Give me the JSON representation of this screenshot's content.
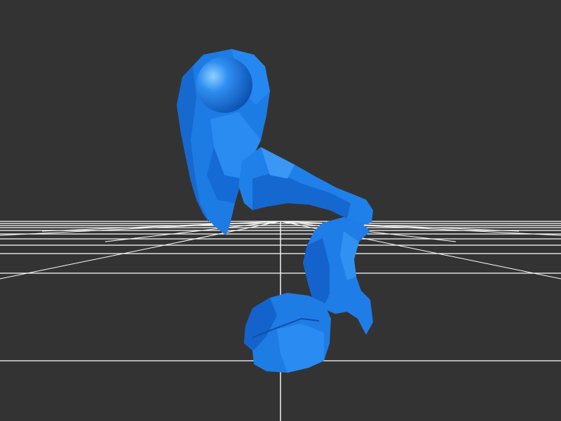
{
  "viewport": {
    "background_color": "#333333",
    "grid_color": "#ffffff",
    "mesh_color": "#1e7de6",
    "mesh_shade_dark": "#0f55b5",
    "mesh_shade_light": "#4aa3ff",
    "sphere_color": "#1f82ee"
  },
  "scene": {
    "grid": "ground-plane-grid",
    "model": "blue-lowpoly-creature-mesh",
    "marker": "sphere-marker"
  }
}
